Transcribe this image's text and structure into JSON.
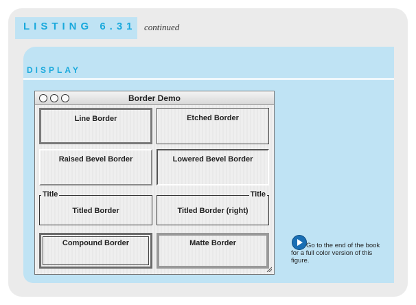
{
  "listing": {
    "label": "LISTING 6.31",
    "continued": "continued"
  },
  "display": {
    "label": "DISPLAY"
  },
  "window": {
    "title": "Border Demo",
    "panels": {
      "line": "Line Border",
      "etched": "Etched Border",
      "raised": "Raised Bevel Border",
      "lowered": "Lowered Bevel Border",
      "titled": "Titled Border",
      "titled_right": "Titled Border (right)",
      "compound": "Compound Border",
      "matte": "Matte Border"
    },
    "border_titles": {
      "left": "Title",
      "right": "Title"
    }
  },
  "note": {
    "text": "Go to the end of the book for a full color version of this figure."
  },
  "colors": {
    "accent": "#1aa9dc",
    "panel": "#bfe3f4",
    "card": "#ebebeb",
    "cd_icon": "#1a6fb4"
  }
}
